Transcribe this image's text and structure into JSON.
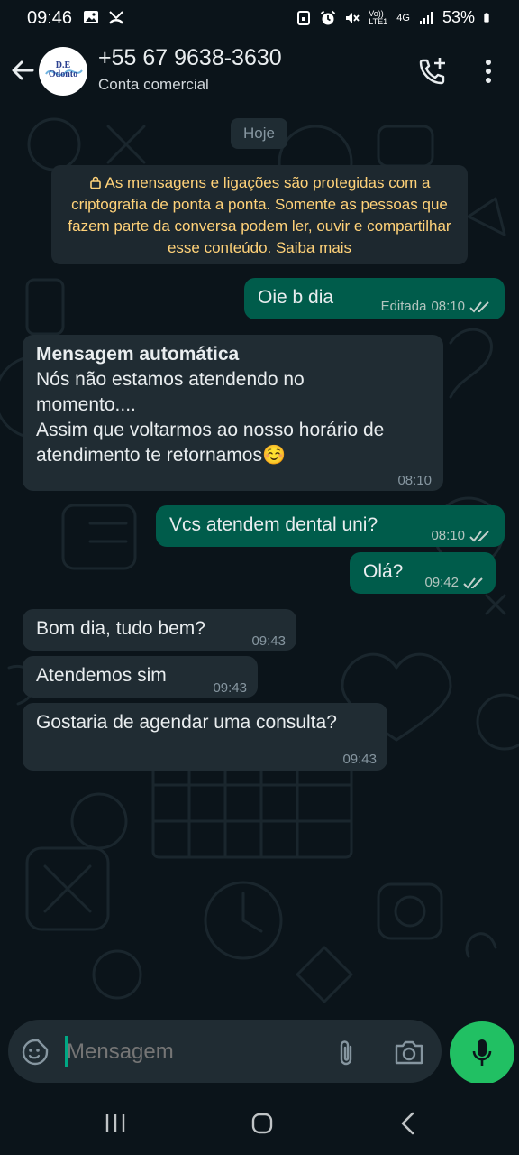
{
  "status_bar": {
    "time": "09:46",
    "network": "4G",
    "volte_label": "Vo)) LTE1",
    "battery": "53%"
  },
  "header": {
    "contact_name": "+55 67 9638-3630",
    "subtitle": "Conta comercial",
    "avatar_text_line1": "D.E",
    "avatar_text_line2": "Odonto",
    "icons": [
      "back-arrow-icon",
      "add-call-icon",
      "more-options-icon"
    ]
  },
  "chat": {
    "date_chip": "Hoje",
    "encryption_notice": "As mensagens e ligações são protegidas com a criptografia de ponta a ponta. Somente as pessoas que fazem parte da conversa podem ler, ouvir e compartilhar esse conteúdo. Saiba mais",
    "messages": [
      {
        "direction": "outgoing",
        "text": "Oie b dia",
        "edited": "Editada",
        "time": "08:10",
        "status": "read"
      },
      {
        "direction": "incoming",
        "title": "Mensagem automática",
        "text": "Nós não estamos atendendo no momento....",
        "text2": "Assim que voltarmos ao nosso horário de atendimento te retornamos☺️",
        "time": "08:10"
      },
      {
        "direction": "outgoing",
        "text": "Vcs atendem dental uni?",
        "time": "08:10",
        "status": "read"
      },
      {
        "direction": "outgoing",
        "text": "Olá?",
        "time": "09:42",
        "status": "read"
      },
      {
        "direction": "incoming",
        "text": "Bom dia, tudo bem?",
        "time": "09:43"
      },
      {
        "direction": "incoming",
        "text": "Atendemos sim",
        "time": "09:43"
      },
      {
        "direction": "incoming",
        "text": "Gostaria de agendar uma consulta?",
        "time": "09:43"
      }
    ]
  },
  "input": {
    "placeholder": "Mensagem"
  },
  "colors": {
    "background": "#0b141a",
    "outgoing_bubble": "#005c4b",
    "incoming_bubble": "#202c33",
    "encryption_text": "#ffd279",
    "read_ticks": "#53bdeb",
    "mic_button": "#21c063"
  }
}
